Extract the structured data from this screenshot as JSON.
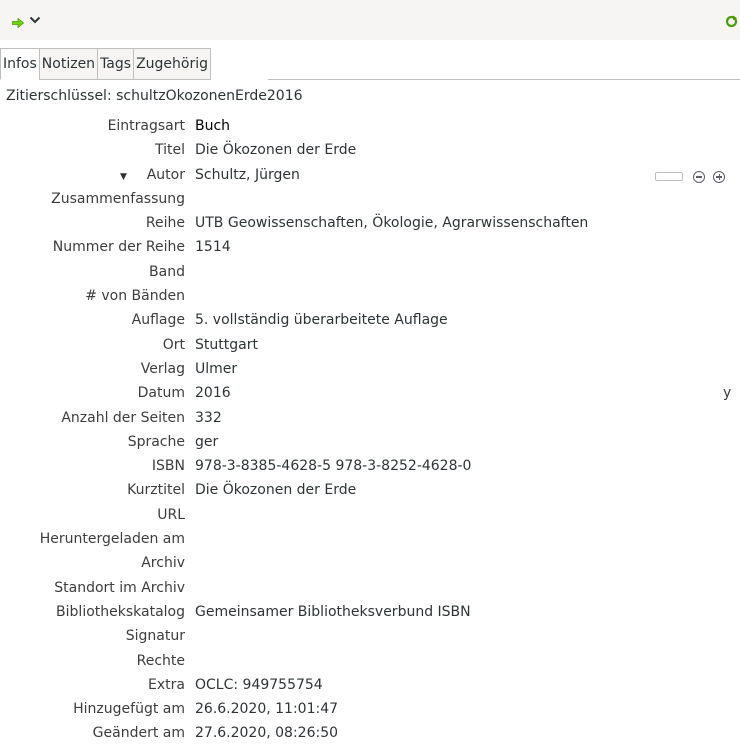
{
  "toolbar": {
    "locate_icon": "green-arrow-right",
    "menu_icon": "chevron-down",
    "sync_icon": "green-refresh"
  },
  "tabs": [
    {
      "label": "Infos",
      "active": true
    },
    {
      "label": "Notizen",
      "active": false
    },
    {
      "label": "Tags",
      "active": false
    },
    {
      "label": "Zugehörig",
      "active": false
    }
  ],
  "citekey": "Zitierschlüssel: schultzOkozonenErde2016",
  "fields": [
    {
      "label": "Eintragsart",
      "value": "Buch"
    },
    {
      "label": "Titel",
      "value": "Die Ökozonen der Erde"
    },
    {
      "label": "Autor",
      "value": "Schultz, Jürgen"
    },
    {
      "label": "Zusammenfassung",
      "value": ""
    },
    {
      "label": "Reihe",
      "value": "UTB Geowissenschaften, Ökologie, Agrarwissenschaften"
    },
    {
      "label": "Nummer der Reihe",
      "value": "1514"
    },
    {
      "label": "Band",
      "value": ""
    },
    {
      "label": "# von Bänden",
      "value": ""
    },
    {
      "label": "Auflage",
      "value": "5. vollständig überarbeitete Auflage"
    },
    {
      "label": "Ort",
      "value": "Stuttgart"
    },
    {
      "label": "Verlag",
      "value": "Ulmer"
    },
    {
      "label": "Datum",
      "value": "2016",
      "flag": "y"
    },
    {
      "label": "Anzahl der Seiten",
      "value": "332"
    },
    {
      "label": "Sprache",
      "value": "ger"
    },
    {
      "label": "ISBN",
      "value": "978-3-8385-4628-5 978-3-8252-4628-0"
    },
    {
      "label": "Kurztitel",
      "value": "Die Ökozonen der Erde"
    },
    {
      "label": "URL",
      "value": ""
    },
    {
      "label": "Heruntergeladen am",
      "value": ""
    },
    {
      "label": "Archiv",
      "value": ""
    },
    {
      "label": "Standort im Archiv",
      "value": ""
    },
    {
      "label": "Bibliothekskatalog",
      "value": "Gemeinsamer Bibliotheksverbund ISBN"
    },
    {
      "label": "Signatur",
      "value": ""
    },
    {
      "label": "Rechte",
      "value": ""
    },
    {
      "label": "Extra",
      "value": "OCLC: 949755754"
    },
    {
      "label": "Hinzugefügt am",
      "value": "26.6.2020, 11:01:47"
    },
    {
      "label": "Geändert am",
      "value": "27.6.2020, 08:26:50"
    }
  ]
}
